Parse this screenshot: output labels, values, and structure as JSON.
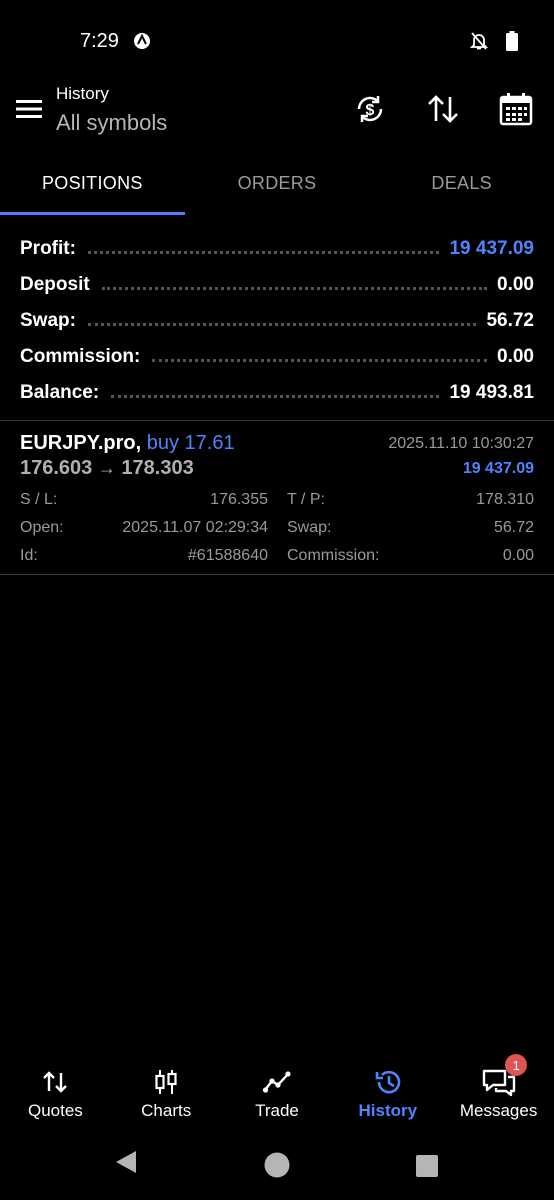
{
  "status_bar": {
    "time": "7:29"
  },
  "app_bar": {
    "title": "History",
    "subtitle": "All symbols"
  },
  "tabs": [
    {
      "label": "POSITIONS",
      "active": true
    },
    {
      "label": "ORDERS",
      "active": false
    },
    {
      "label": "DEALS",
      "active": false
    }
  ],
  "summary": [
    {
      "label": "Profit:",
      "value": "19 437.09",
      "highlight": true
    },
    {
      "label": "Deposit",
      "value": "0.00",
      "highlight": false
    },
    {
      "label": "Swap:",
      "value": "56.72",
      "highlight": false
    },
    {
      "label": "Commission:",
      "value": "0.00",
      "highlight": false
    },
    {
      "label": "Balance:",
      "value": "19 493.81",
      "highlight": false
    }
  ],
  "position": {
    "symbol": "EURJPY.pro,",
    "side": "buy 17.61",
    "close_time": "2025.11.10 10:30:27",
    "price_open": "176.603",
    "arrow": "→",
    "price_close": "178.303",
    "profit": "19 437.09",
    "details": {
      "sl_label": "S / L:",
      "sl_value": "176.355",
      "tp_label": "T / P:",
      "tp_value": "178.310",
      "open_label": "Open:",
      "open_value": "2025.11.07 02:29:34",
      "swap_label": "Swap:",
      "swap_value": "56.72",
      "id_label": "Id:",
      "id_value": "#61588640",
      "commission_label": "Commission:",
      "commission_value": "0.00"
    }
  },
  "bottom_nav": [
    {
      "label": "Quotes",
      "icon": "quotes-icon",
      "active": false
    },
    {
      "label": "Charts",
      "icon": "charts-icon",
      "active": false
    },
    {
      "label": "Trade",
      "icon": "trade-icon",
      "active": false
    },
    {
      "label": "History",
      "icon": "history-icon",
      "active": true
    },
    {
      "label": "Messages",
      "icon": "messages-icon",
      "active": false,
      "badge": "1"
    }
  ],
  "colors": {
    "accent": "#4f84ff",
    "badge": "#e05454",
    "background": "#000000"
  }
}
